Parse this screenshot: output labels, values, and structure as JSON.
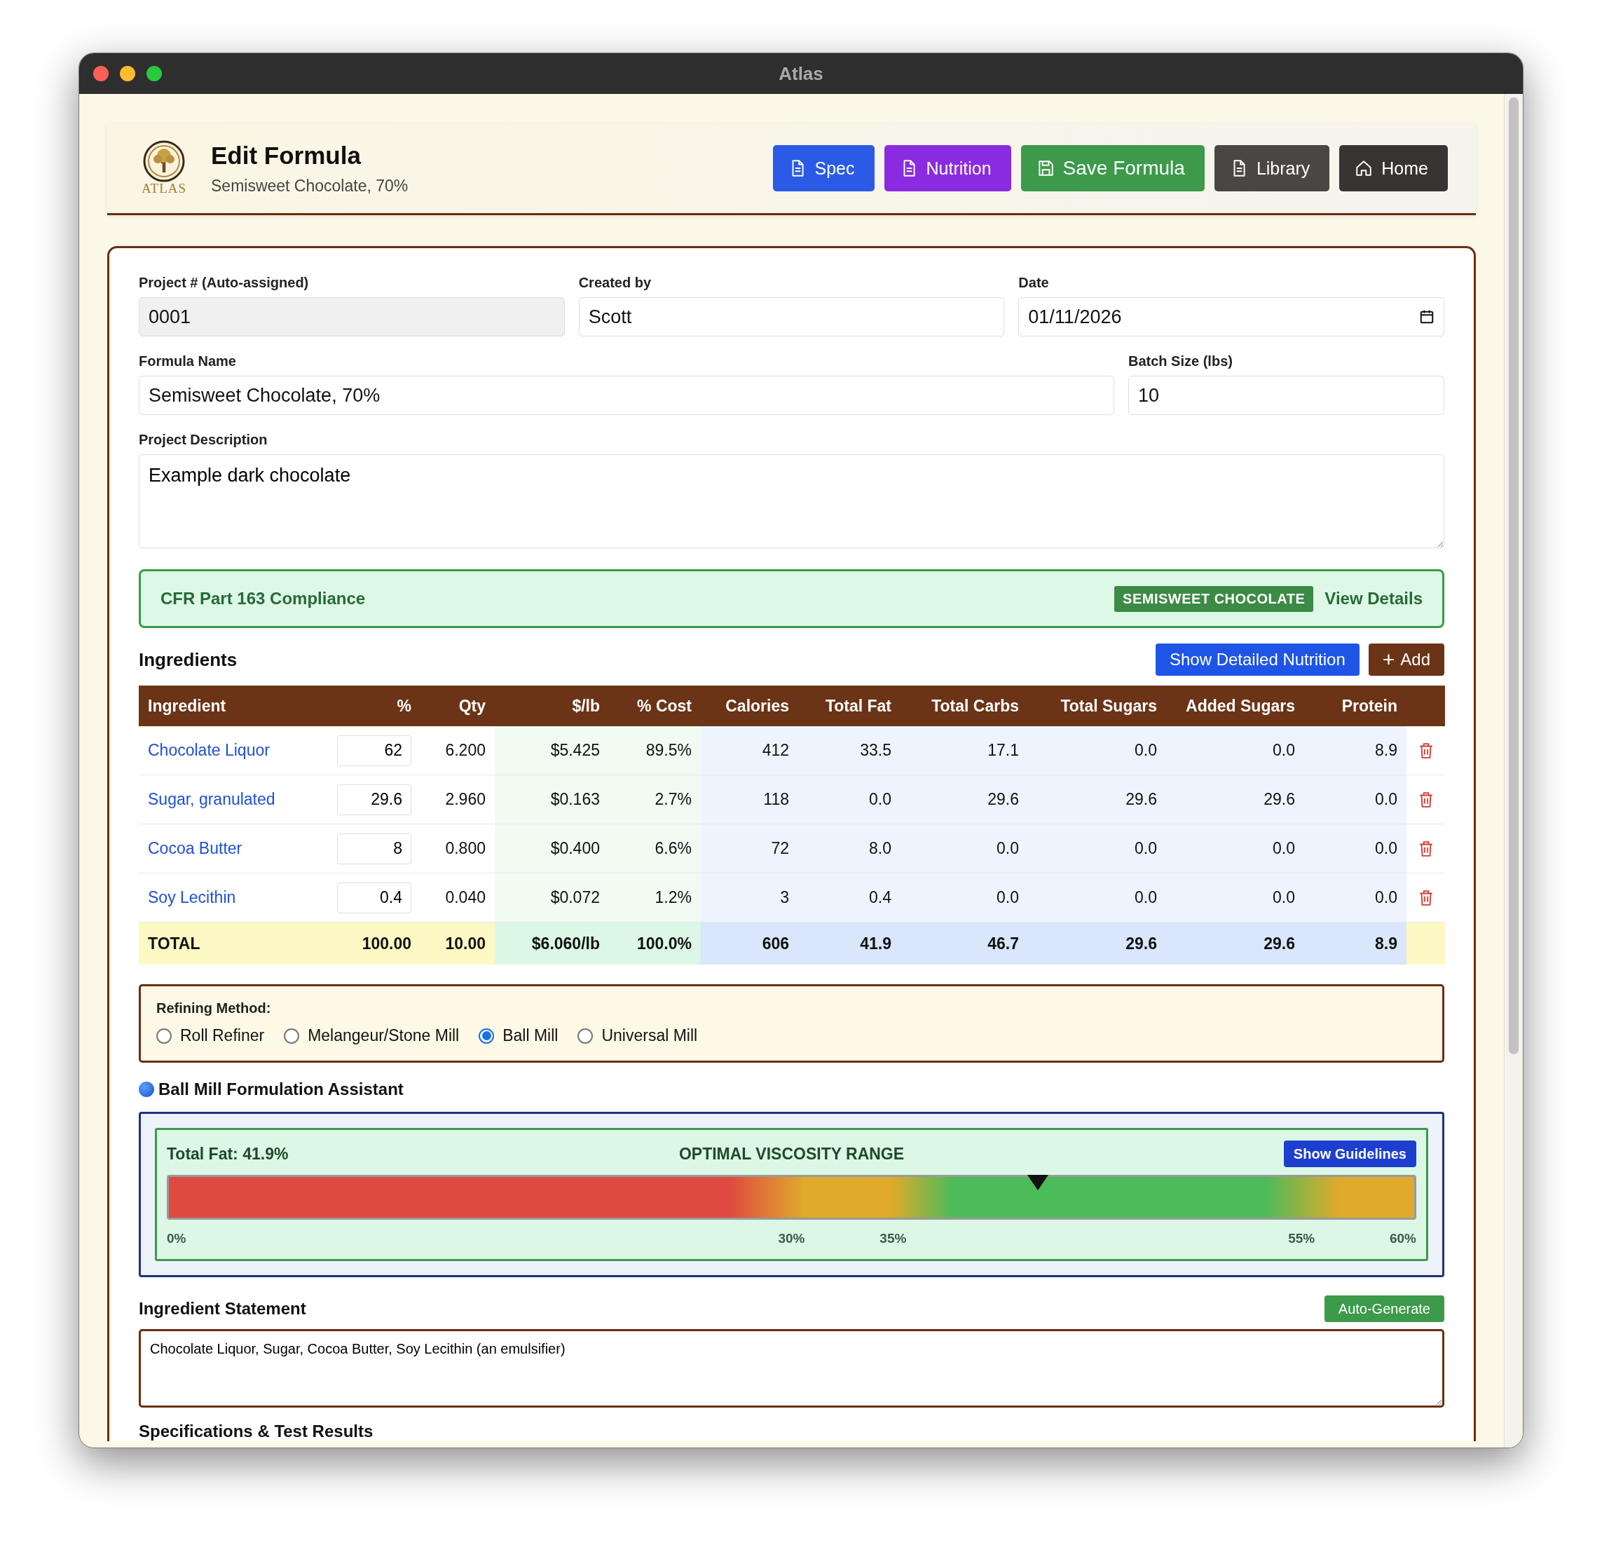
{
  "window": {
    "title": "Atlas"
  },
  "header": {
    "logo_text": "ATLAS",
    "title": "Edit Formula",
    "subtitle": "Semisweet Chocolate, 70%",
    "buttons": [
      {
        "label": "Spec",
        "kind": "doc",
        "color": "#2b5be6"
      },
      {
        "label": "Nutrition",
        "kind": "doc",
        "color": "#8a2be2"
      },
      {
        "label": "Save Formula",
        "kind": "save",
        "color": "#3c9a4a"
      },
      {
        "label": "Library",
        "kind": "doc",
        "color": "#4a4643"
      },
      {
        "label": "Home",
        "kind": "home",
        "color": "#373533"
      }
    ]
  },
  "form": {
    "project_number": {
      "label": "Project # (Auto-assigned)",
      "value": "0001",
      "disabled": true
    },
    "created_by": {
      "label": "Created by",
      "value": "Scott"
    },
    "date": {
      "label": "Date",
      "value": "01/11/2026"
    },
    "formula_name": {
      "label": "Formula Name",
      "value": "Semisweet Chocolate, 70%"
    },
    "batch_size": {
      "label": "Batch Size (lbs)",
      "value": "10"
    },
    "description": {
      "label": "Project Description",
      "value": "Example dark chocolate"
    }
  },
  "compliance": {
    "title": "CFR Part 163 Compliance",
    "badge": "SEMISWEET CHOCOLATE",
    "link": "View Details"
  },
  "ingredients": {
    "title": "Ingredients",
    "buttons": [
      {
        "label": "Show Detailed Nutrition",
        "kind": "plain"
      },
      {
        "label": "Add",
        "kind": "add",
        "icon": "+"
      }
    ],
    "columns": [
      "Ingredient",
      "%",
      "Qty",
      "$/lb",
      "% Cost",
      "Calories",
      "Total Fat",
      "Total Carbs",
      "Total Sugars",
      "Added Sugars",
      "Protein"
    ],
    "rows": [
      {
        "ingredient": "Chocolate Liquor",
        "percent": "62",
        "values": [
          "6.200",
          "$5.425",
          "89.5%",
          "412",
          "33.5",
          "17.1",
          "0.0",
          "0.0",
          "8.9"
        ]
      },
      {
        "ingredient": "Sugar, granulated",
        "percent": "29.6",
        "values": [
          "2.960",
          "$0.163",
          "2.7%",
          "118",
          "0.0",
          "29.6",
          "29.6",
          "29.6",
          "0.0"
        ]
      },
      {
        "ingredient": "Cocoa Butter",
        "percent": "8",
        "values": [
          "0.800",
          "$0.400",
          "6.6%",
          "72",
          "8.0",
          "0.0",
          "0.0",
          "0.0",
          "0.0"
        ]
      },
      {
        "ingredient": "Soy Lecithin",
        "percent": "0.4",
        "values": [
          "0.040",
          "$0.072",
          "1.2%",
          "3",
          "0.4",
          "0.0",
          "0.0",
          "0.0",
          "0.0"
        ]
      }
    ],
    "total": {
      "label": "TOTAL",
      "values": [
        "100.00",
        "10.00",
        "$6.060/lb",
        "100.0%",
        "606",
        "41.9",
        "46.7",
        "29.6",
        "29.6",
        "8.9"
      ]
    }
  },
  "refining": {
    "label": "Refining Method:",
    "options": [
      {
        "label": "Roll Refiner",
        "selected": false
      },
      {
        "label": "Melangeur/Stone Mill",
        "selected": false
      },
      {
        "label": "Ball Mill",
        "selected": true
      },
      {
        "label": "Universal Mill",
        "selected": false
      }
    ]
  },
  "assistant": {
    "title": "Ball Mill Formulation Assistant",
    "reading": "Total Fat: 41.9%",
    "status": "OPTIMAL VISCOSITY RANGE",
    "button": "Show Guidelines",
    "level": 0.698,
    "ticks": [
      {
        "label": "0%",
        "level": 0
      },
      {
        "label": "30%",
        "level": 0.5
      },
      {
        "label": "35%",
        "level": 0.583
      },
      {
        "label": "55%",
        "level": 0.917
      },
      {
        "label": "60%",
        "level": 1
      }
    ]
  },
  "statement": {
    "title": "Ingredient Statement",
    "button": "Auto-Generate",
    "value": "Chocolate Liquor, Sugar, Cocoa Butter, Soy Lecithin (an emulsifier)"
  },
  "next_section": {
    "title": "Specifications & Test Results"
  }
}
